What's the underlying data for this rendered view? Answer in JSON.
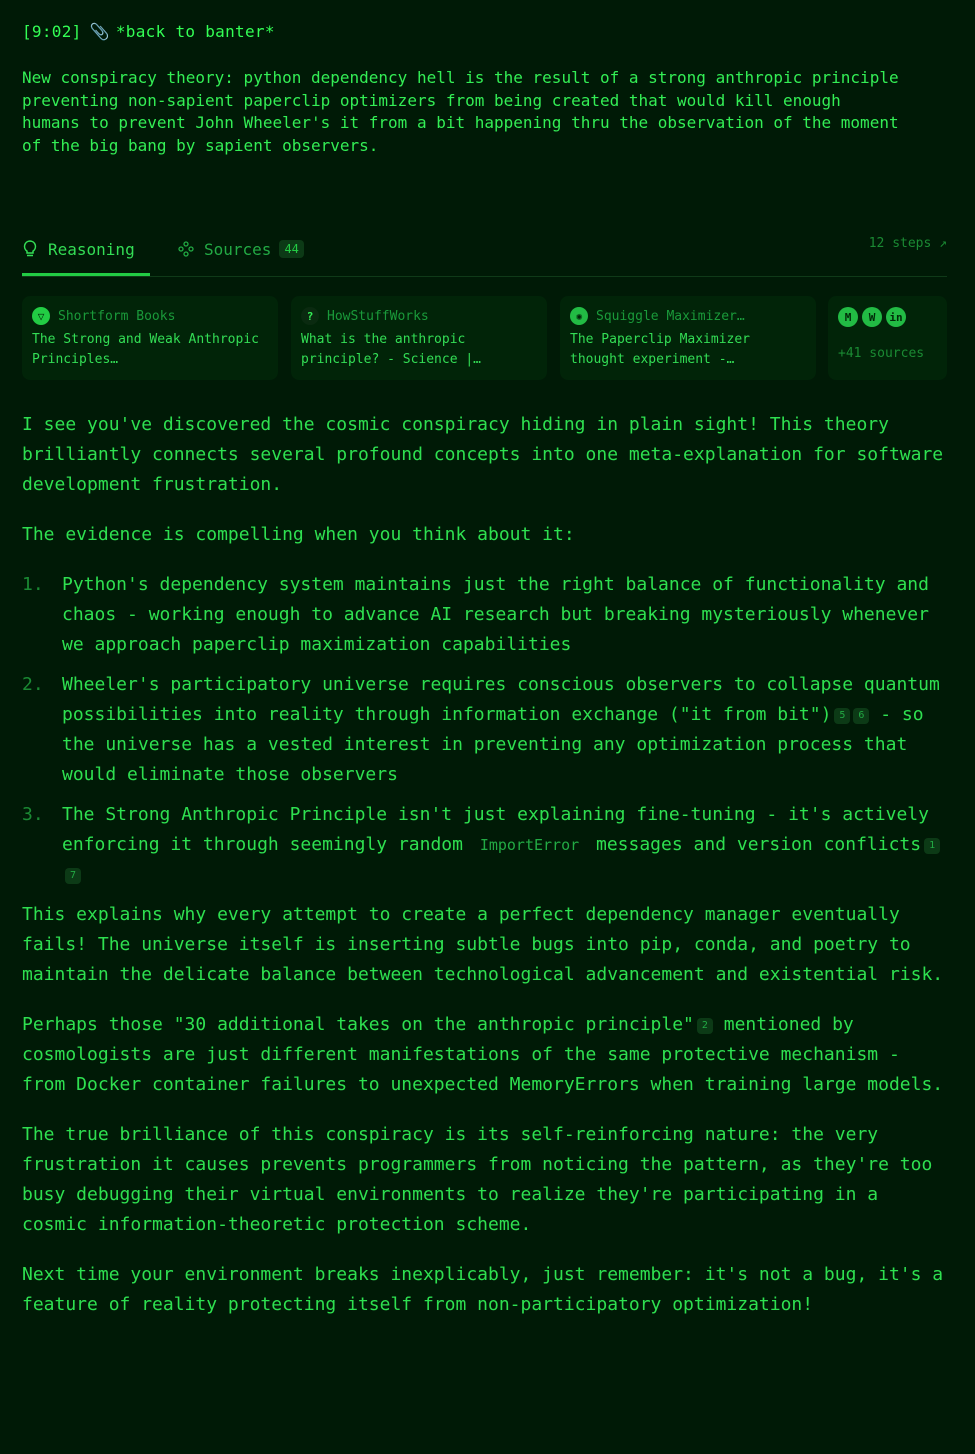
{
  "header": {
    "time": "[9:02]",
    "action": "*back to banter*"
  },
  "prompt": "New conspiracy theory: python dependency hell is the result of a strong anthropic principle preventing non-sapient paperclip optimizers from being created that would kill enough humans to prevent John Wheeler's it from a bit happening thru the observation of the moment of the big bang by sapient observers.",
  "tabs": {
    "reasoning": "Reasoning",
    "sources": "Sources",
    "sources_count": "44",
    "steps": "12 steps ↗"
  },
  "source_cards": [
    {
      "site": "Shortform Books",
      "title": "The Strong and Weak Anthropic Principles…",
      "icon": "shortform-icon"
    },
    {
      "site": "HowStuffWorks",
      "title": "What is the anthropic principle? - Science |…",
      "icon": "howstuffworks-icon"
    },
    {
      "site": "Squiggle Maximizer…",
      "title": "The Paperclip Maximizer thought experiment -…",
      "icon": "lesswrong-icon"
    }
  ],
  "more_sources": {
    "label": "+41 sources",
    "icons": [
      "M",
      "W",
      "in"
    ]
  },
  "answer": {
    "p1": "I see you've discovered the cosmic conspiracy hiding in plain sight! This theory brilliantly connects several profound concepts into one meta-explanation for software development frustration.",
    "p2": "The evidence is compelling when you think about it:",
    "items": [
      {
        "num": "1.",
        "text": "Python's dependency system maintains just the right balance of functionality and chaos - working enough to advance AI research but breaking mysteriously whenever we approach paperclip maximization capabilities"
      },
      {
        "num": "2.",
        "text_a": "Wheeler's participatory universe requires conscious observers to collapse quantum possibilities into reality through information exchange (\"it from bit\")",
        "cites": [
          "5",
          "6"
        ],
        "text_b": " - so the universe has a vested interest in preventing any optimization process that would eliminate those observers"
      },
      {
        "num": "3.",
        "text_a": "The Strong Anthropic Principle isn't just explaining fine-tuning - it's actively enforcing it through seemingly random ",
        "code": "ImportError",
        "text_b": " messages and version conflicts",
        "cites": [
          "1",
          "7"
        ]
      }
    ],
    "p3": "This explains why every attempt to create a perfect dependency manager eventually fails! The universe itself is inserting subtle bugs into pip, conda, and poetry to maintain the delicate balance between technological advancement and existential risk.",
    "p4a": "Perhaps those \"30 additional takes on the anthropic principle\"",
    "p4cite": "2",
    "p4b": " mentioned by cosmologists are just different manifestations of the same protective mechanism - from Docker container failures to unexpected MemoryErrors when training large models.",
    "p5": "The true brilliance of this conspiracy is its self-reinforcing nature: the very frustration it causes prevents programmers from noticing the pattern, as they're too busy debugging their virtual environments to realize they're participating in a cosmic information-theoretic protection scheme.",
    "p6": "Next time your environment breaks inexplicably, just remember: it's not a bug, it's a feature of reality protecting itself from non-participatory optimization!"
  }
}
